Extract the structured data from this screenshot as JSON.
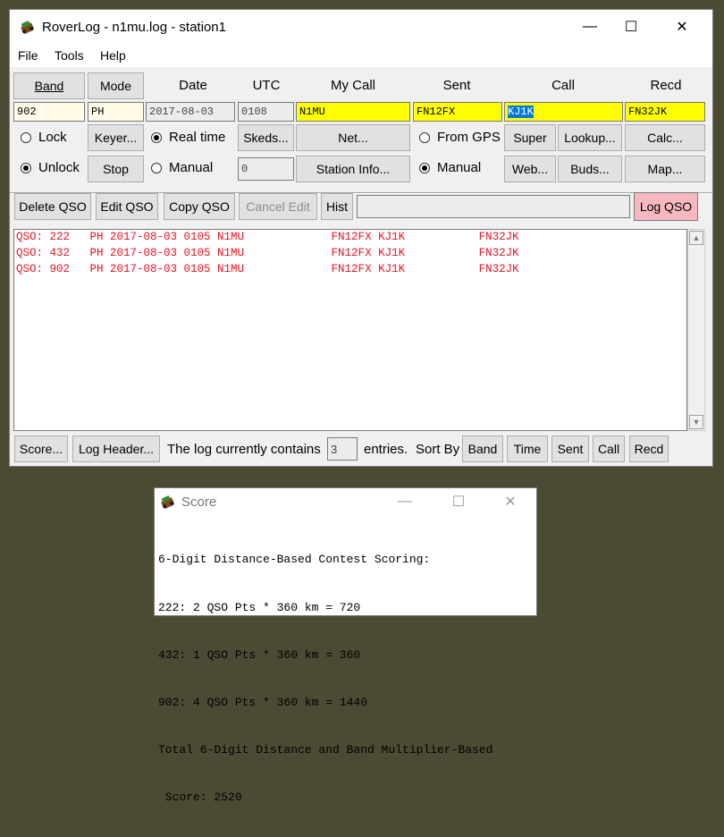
{
  "main_window": {
    "title": "RoverLog - n1mu.log - station1",
    "controls": {
      "minimize": "—",
      "maximize": "☐",
      "close": "✕"
    },
    "menu": [
      "File",
      "Tools",
      "Help"
    ],
    "buttons": {
      "band": "Band",
      "mode": "Mode",
      "keyer": "Keyer...",
      "stop": "Stop",
      "skeds": "Skeds...",
      "net": "Net...",
      "station_info": "Station Info...",
      "super": "Super",
      "lookup": "Lookup...",
      "calc": "Calc...",
      "web": "Web...",
      "buds": "Buds...",
      "map": "Map..."
    },
    "headers": {
      "date": "Date",
      "utc": "UTC",
      "my_call": "My Call",
      "sent": "Sent",
      "call": "Call",
      "recd": "Recd"
    },
    "fields": {
      "band": "902",
      "mode": "PH",
      "date": "2017-08-03",
      "utc": "0108",
      "my_call": "N1MU",
      "sent": "FN12FX",
      "call": "KJ1K",
      "recd": "FN32JK",
      "manual_time": "0"
    },
    "radios": {
      "lock": "Lock",
      "unlock": "Unlock",
      "real_time": "Real time",
      "manual_time": "Manual",
      "from_gps": "From GPS",
      "manual_grid": "Manual"
    },
    "edit_buttons": {
      "delete_qso": "Delete QSO",
      "edit_qso": "Edit QSO",
      "copy_qso": "Copy QSO",
      "cancel_edit": "Cancel Edit",
      "hist": "Hist",
      "log_qso": "Log QSO"
    },
    "log_lines": [
      "QSO: 222   PH 2017-08-03 0105 N1MU             FN12FX KJ1K           FN32JK",
      "QSO: 432   PH 2017-08-03 0105 N1MU             FN12FX KJ1K           FN32JK",
      "QSO: 902   PH 2017-08-03 0105 N1MU             FN12FX KJ1K           FN32JK"
    ],
    "bottom": {
      "score": "Score...",
      "log_header": "Log Header...",
      "contains_text": "The log currently contains",
      "entry_count": "3",
      "entries_text": "entries.",
      "sort_by": "Sort By",
      "sort_buttons": [
        "Band",
        "Time",
        "Sent",
        "Call",
        "Recd"
      ]
    }
  },
  "score_window": {
    "title": "Score",
    "controls": {
      "minimize": "—",
      "maximize": "☐",
      "close": "✕"
    },
    "lines": [
      "6-Digit Distance-Based Contest Scoring:",
      "222: 2 QSO Pts * 360 km = 720",
      "432: 1 QSO Pts * 360 km = 360",
      "902: 4 QSO Pts * 360 km = 1440",
      "Total 6-Digit Distance and Band Multiplier-Based",
      " Score: 2520"
    ]
  },
  "colors": {
    "required_field": "#ffff00",
    "log_text": "#e81123",
    "log_button": "#f7b8c0",
    "selection": "#0078d7",
    "desktop": "#4b4b35"
  }
}
